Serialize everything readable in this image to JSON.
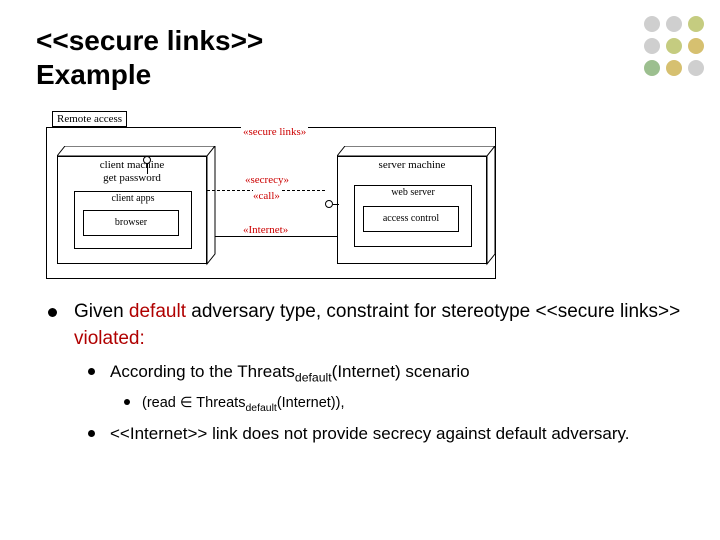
{
  "title_line1": "<<secure links>>",
  "title_line2": "Example",
  "diagram": {
    "package_label": "Remote access",
    "package_stereotype": "«secure links»",
    "client_node": {
      "line1": "client machine",
      "line2": "get password",
      "component": "client apps",
      "inner": "browser"
    },
    "server_node": {
      "name": "server machine",
      "component": "web server",
      "inner": "access control"
    },
    "link_secrecy": "«secrecy»",
    "link_call": "«call»",
    "link_internet": "«Internet»"
  },
  "bullet_main_a": "Given ",
  "bullet_main_b": "default",
  "bullet_main_c": " adversary type, constraint for stereotype <<secure links>> ",
  "bullet_main_d": "violated:",
  "sub1_a": "According to the ",
  "sub1_b": "Threats",
  "sub1_c": "default",
  "sub1_d": "(Internet)",
  "sub1_e": " scenario",
  "sub2_a": "(read ",
  "sub2_elem": "∈",
  "sub2_b": " Threats",
  "sub2_c": "default",
  "sub2_d": "(Internet))",
  "sub2_e": ",",
  "sub3": "<<Internet>> link does not provide secrecy against default adversary."
}
